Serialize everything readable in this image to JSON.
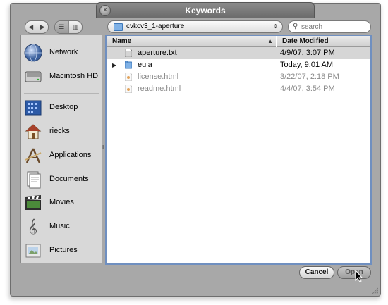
{
  "window": {
    "title": "Keywords"
  },
  "toolbar": {
    "back_glyph": "◀",
    "forward_glyph": "▶",
    "view_list_glyph": "☰",
    "view_column_glyph": "▥",
    "location": "cvkcv3_1-aperture",
    "location_arrows": "⇕"
  },
  "search": {
    "placeholder": "search"
  },
  "sidebar": {
    "items": [
      {
        "label": "Network",
        "icon": "network-globe-icon"
      },
      {
        "label": "Macintosh HD",
        "icon": "hard-drive-icon"
      },
      {
        "label": "Desktop",
        "icon": "desktop-icon"
      },
      {
        "label": "riecks",
        "icon": "home-icon"
      },
      {
        "label": "Applications",
        "icon": "applications-icon"
      },
      {
        "label": "Documents",
        "icon": "documents-icon"
      },
      {
        "label": "Movies",
        "icon": "movies-icon"
      },
      {
        "label": "Music",
        "icon": "music-icon"
      },
      {
        "label": "Pictures",
        "icon": "pictures-icon"
      }
    ]
  },
  "columns": {
    "name": "Name",
    "date": "Date Modified",
    "sort_glyph": "▲"
  },
  "files": [
    {
      "name": "aperture.txt",
      "date": "4/9/07, 3:07 PM",
      "kind": "text",
      "selected": true,
      "enabled": true
    },
    {
      "name": "eula",
      "date": "Today, 9:01 AM",
      "kind": "folder",
      "selected": false,
      "enabled": true
    },
    {
      "name": "license.html",
      "date": "3/22/07, 2:18 PM",
      "kind": "html",
      "selected": false,
      "enabled": false
    },
    {
      "name": "readme.html",
      "date": "4/4/07, 3:54 PM",
      "kind": "html",
      "selected": false,
      "enabled": false
    }
  ],
  "buttons": {
    "cancel": "Cancel",
    "open": "Open"
  },
  "colors": {
    "selection_border": "#6f8fc0",
    "folder_blue": "#7fb1e6",
    "dim_text": "#8a8a8a"
  }
}
